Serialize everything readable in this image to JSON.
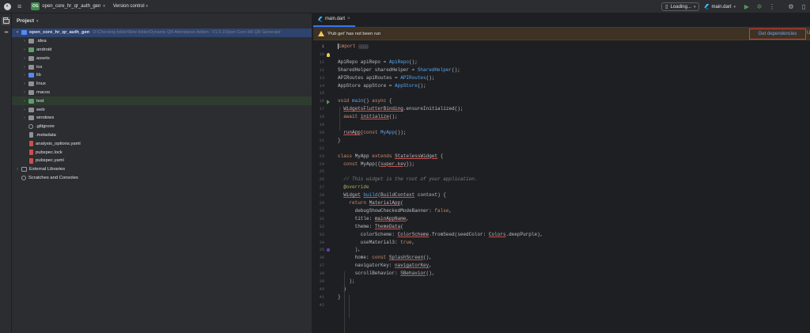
{
  "titlebar": {
    "project_badge": "OG",
    "project_name": "open_core_hr_qr_auth_gen",
    "version_control": "Version control",
    "device": "Loading...",
    "run_config": "main.dart"
  },
  "project_panel": {
    "title": "Project",
    "tree": [
      {
        "indent": 0,
        "arrow": "▾",
        "icon": "folder blue",
        "icon_name": "folder-icon",
        "label": "open_core_hr_qr_auth_gen",
        "path": "D:\\Checking folder\\New folder\\Dynamic QR Attendance Addon - V1.0.1\\Open Core HR QR Generator",
        "root": true,
        "state": "selected"
      },
      {
        "indent": 1,
        "arrow": "›",
        "icon": "folder",
        "icon_name": "folder-icon",
        "label": ".idea"
      },
      {
        "indent": 1,
        "arrow": "›",
        "icon": "folder green",
        "icon_name": "folder-icon",
        "label": "android"
      },
      {
        "indent": 1,
        "arrow": "›",
        "icon": "folder",
        "icon_name": "folder-icon",
        "label": "assets"
      },
      {
        "indent": 1,
        "arrow": "›",
        "icon": "folder",
        "icon_name": "folder-icon",
        "label": "ios"
      },
      {
        "indent": 1,
        "arrow": "›",
        "icon": "folder blue",
        "icon_name": "source-folder-icon",
        "label": "lib"
      },
      {
        "indent": 1,
        "arrow": "›",
        "icon": "folder",
        "icon_name": "folder-icon",
        "label": "linux"
      },
      {
        "indent": 1,
        "arrow": "›",
        "icon": "folder",
        "icon_name": "folder-icon",
        "label": "macos"
      },
      {
        "indent": 1,
        "arrow": "›",
        "icon": "folder green",
        "icon_name": "test-folder-icon",
        "label": "test",
        "state": "hl"
      },
      {
        "indent": 1,
        "arrow": "›",
        "icon": "folder",
        "icon_name": "folder-icon",
        "label": "web"
      },
      {
        "indent": 1,
        "arrow": "›",
        "icon": "folder",
        "icon_name": "folder-icon",
        "label": "windows"
      },
      {
        "indent": 1,
        "arrow": "",
        "icon": "ignore",
        "icon_name": "gitignore-icon",
        "label": ".gitignore"
      },
      {
        "indent": 1,
        "arrow": "",
        "icon": "file gray",
        "icon_name": "file-icon",
        "label": ".metadata"
      },
      {
        "indent": 1,
        "arrow": "",
        "icon": "file red",
        "icon_name": "yaml-file-icon",
        "label": "analysis_options.yaml"
      },
      {
        "indent": 1,
        "arrow": "",
        "icon": "file red",
        "icon_name": "lock-file-icon",
        "label": "pubspec.lock"
      },
      {
        "indent": 1,
        "arrow": "",
        "icon": "file red",
        "icon_name": "yaml-file-icon",
        "label": "pubspec.yaml"
      },
      {
        "indent": 0,
        "arrow": "›",
        "icon": "libs",
        "icon_name": "libraries-icon",
        "label": "External Libraries"
      },
      {
        "indent": 0,
        "arrow": "",
        "icon": "scratch",
        "icon_name": "scratches-icon",
        "label": "Scratches and Consoles"
      }
    ]
  },
  "editor": {
    "tab_label": "main.dart",
    "banner_text": "'Pub get' has not been run",
    "banner_action": "Get dependencies",
    "banner_extra": "U",
    "lines": [
      {
        "n": "1",
        "html": "<span class=\"kw\">import</span> <span class=\"fold-box\">...</span>",
        "current": true
      },
      {
        "n": "10",
        "html": ""
      },
      {
        "n": "11",
        "html": "ApiRepo apiRepo = <span class=\"fn\">ApiRepo</span>();"
      },
      {
        "n": "12",
        "html": "SharedHelper sharedHelper = <span class=\"fn\">SharedHelper</span>();"
      },
      {
        "n": "13",
        "html": "APIRoutes apiRoutes = <span class=\"fn\">APIRoutes</span>();"
      },
      {
        "n": "14",
        "html": "AppStore appStore = <span class=\"fn\">AppStore</span>();"
      },
      {
        "n": "15",
        "html": ""
      },
      {
        "n": "16",
        "html": "<span class=\"kw\">void</span> <span class=\"fn\">main</span>() <span class=\"kw\">async</span> {"
      },
      {
        "n": "17",
        "html": "  <span class=\"ul\">WidgetsFlutterBinding</span>.ensureInitialized();"
      },
      {
        "n": "18",
        "html": "  <span class=\"kw\">await</span> <span class=\"ul\">initialize</span>();"
      },
      {
        "n": "19",
        "html": ""
      },
      {
        "n": "20",
        "html": "  <span class=\"ul\">runApp</span>(<span class=\"kw\">const</span> <span class=\"fn\">MyApp</span>());"
      },
      {
        "n": "21",
        "html": "}"
      },
      {
        "n": "22",
        "html": ""
      },
      {
        "n": "23",
        "html": "<span class=\"kw\">class</span> MyApp <span class=\"kw\">extends</span> <span class=\"ul\">StatelessWidget</span> {"
      },
      {
        "n": "24",
        "html": "  <span class=\"kw\">const</span> MyApp({<span class=\"ul\">super.key</span>});"
      },
      {
        "n": "25",
        "html": ""
      },
      {
        "n": "26",
        "html": "  <span class=\"cm\">// This widget is the root of your application.</span>"
      },
      {
        "n": "27",
        "html": "  <span class=\"an\">@override</span>"
      },
      {
        "n": "28",
        "html": "  <span class=\"ul\">Widget</span> <span class=\"fn ul\">build</span>(<span class=\"ul\">BuildContext</span> context) {"
      },
      {
        "n": "29",
        "html": "    <span class=\"kw\">return</span> <span class=\"ul\">MaterialApp</span>("
      },
      {
        "n": "30",
        "html": "      debugShowCheckedModeBanner: <span class=\"kw\">false</span>,"
      },
      {
        "n": "31",
        "html": "      title: <span class=\"ul\">mainAppName</span>,"
      },
      {
        "n": "32",
        "html": "      theme: <span class=\"ul\">ThemeData</span>("
      },
      {
        "n": "33",
        "html": "        colorScheme: <span class=\"ul\">ColorScheme</span>.fromSeed(seedColor: <span class=\"ul\">Colors</span>.deepPurple),"
      },
      {
        "n": "34",
        "html": "        useMaterial3: <span class=\"kw\">true</span>,"
      },
      {
        "n": "35",
        "html": "      ),"
      },
      {
        "n": "36",
        "html": "      home: <span class=\"kw\">const</span> <span class=\"ul\">SplashScreen</span>(),"
      },
      {
        "n": "37",
        "html": "      navigatorKey: <span class=\"ul\">navigatorKey</span>,"
      },
      {
        "n": "38",
        "html": "      scrollBehavior: <span class=\"ul\">SBehavior</span>(),"
      },
      {
        "n": "39",
        "html": "    );"
      },
      {
        "n": "40",
        "html": "  }"
      },
      {
        "n": "41",
        "html": "}"
      },
      {
        "n": "42",
        "html": ""
      }
    ]
  }
}
